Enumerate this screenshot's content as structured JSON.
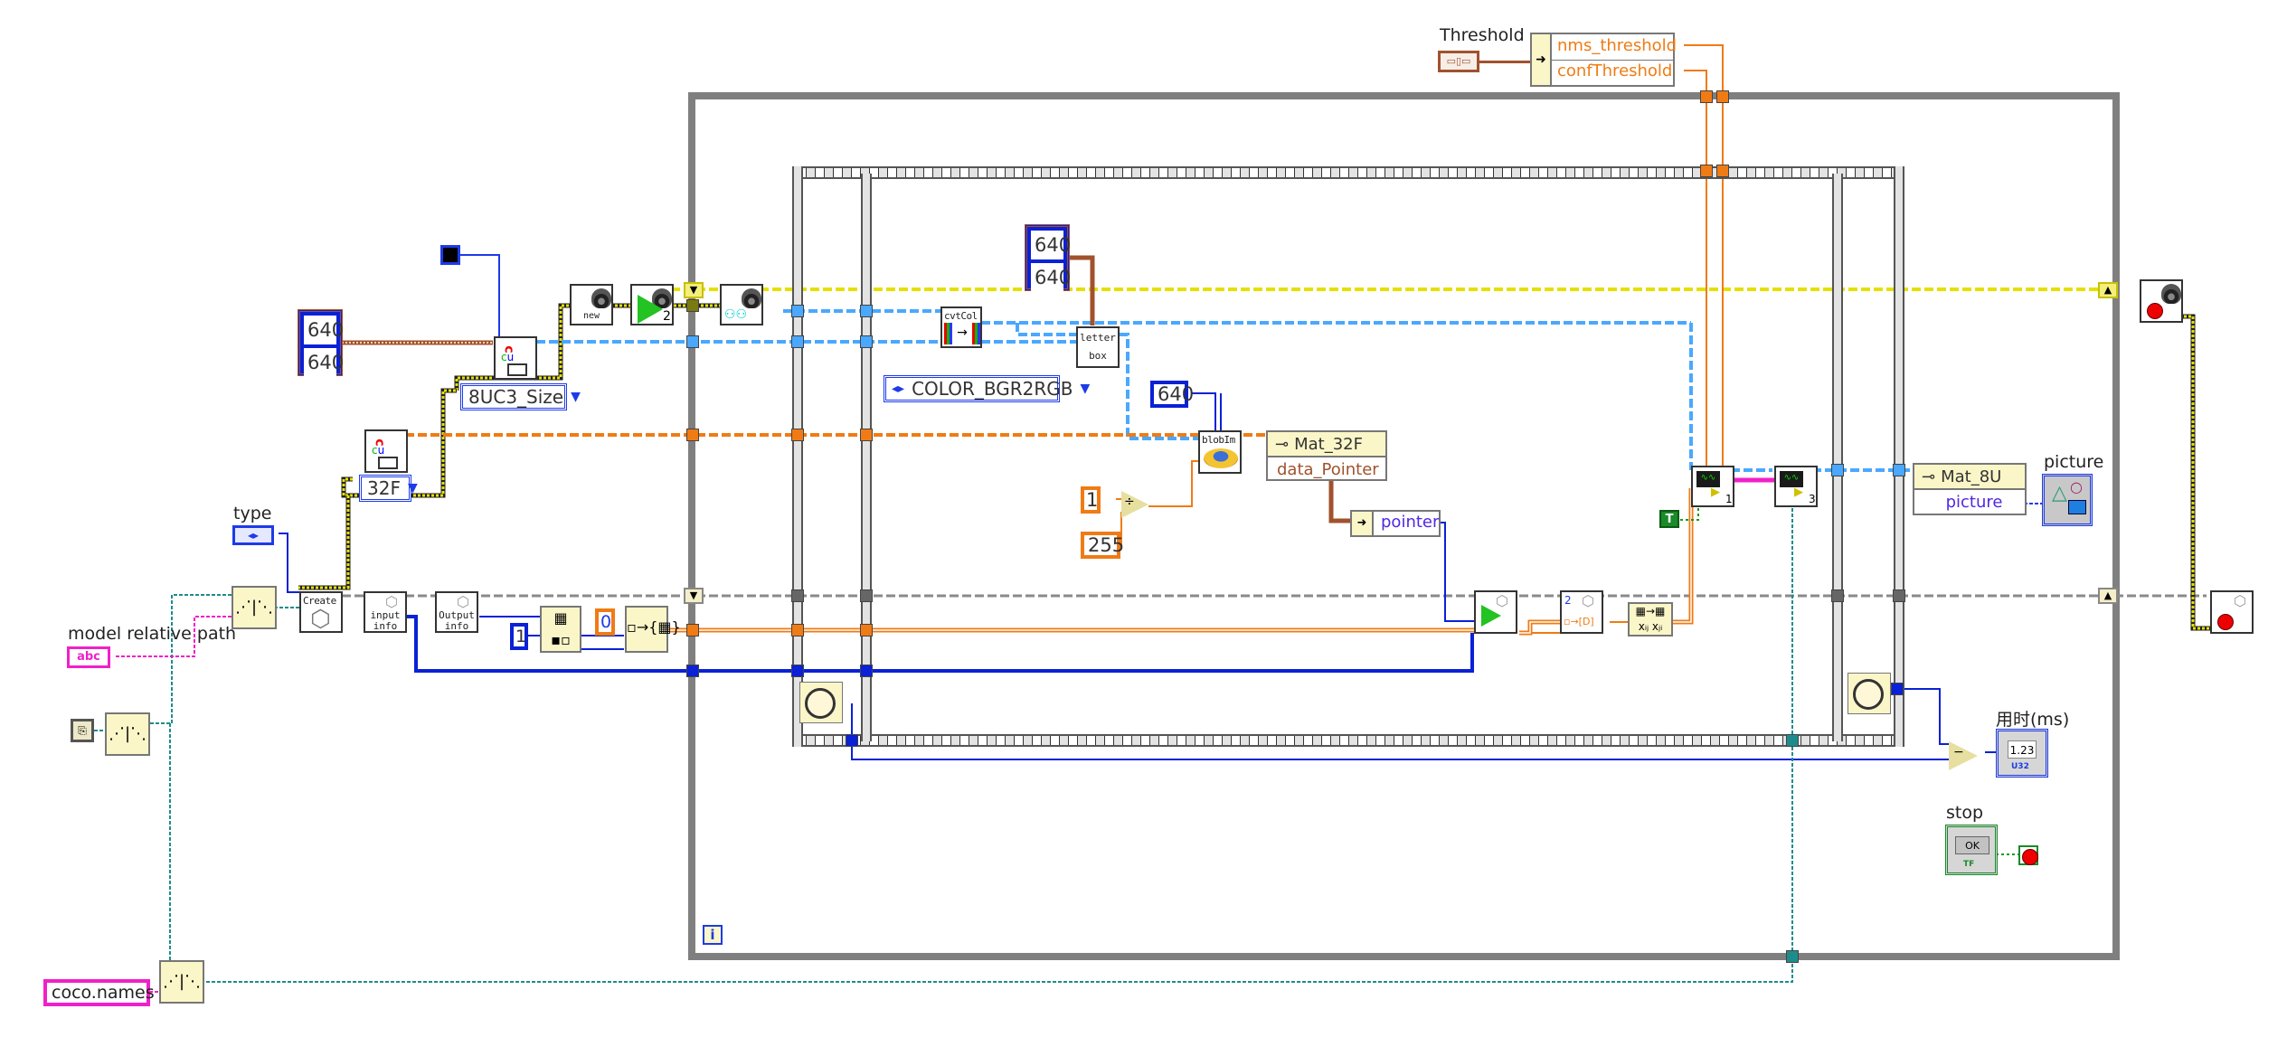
{
  "diagram": {
    "type": "LabVIEW block diagram",
    "controls": {
      "threshold": {
        "label": "Threshold",
        "bundle_fields": [
          "nms_threshold",
          "confThreshold"
        ]
      },
      "type": {
        "label": "type"
      },
      "model_path": {
        "label": "model relative path",
        "glyph": "abc"
      },
      "coco_names": {
        "value": "coco.names"
      },
      "stop": {
        "label": "stop",
        "button_text": "OK",
        "type_badge": "TF"
      }
    },
    "indicators": {
      "elapsed": {
        "label": "用时(ms)",
        "display": "1.23",
        "type_badge": "U32"
      },
      "picture": {
        "label": "picture"
      }
    },
    "constants": {
      "size_cluster_outer": [
        "640",
        "640"
      ],
      "size_cluster_inner": [
        "640",
        "640"
      ],
      "blob_size": "640",
      "div_numerator": "1",
      "div_denominator": "255",
      "index_zero": "0",
      "reshape_one": "1",
      "boolean_true": "T"
    },
    "rings": {
      "mat_type_8uc3": "8UC3_Size",
      "mat_type_32f": "32F",
      "color_conversion": "COLOR_BGR2RGB"
    },
    "subvis": {
      "camera_new": "new",
      "camera_start_index": "2",
      "dnn_create": "Create",
      "input_info": [
        "input",
        "info"
      ],
      "output_info": [
        "Output",
        "info"
      ],
      "cvtcolor": "cvtCol",
      "letterbox": [
        "letter",
        "box"
      ],
      "blob": "blobIm",
      "infer_output_index": "2",
      "draw_result_1": "1",
      "draw_result_3": "3"
    },
    "property_nodes": {
      "mat32f": {
        "class": "Mat_32F",
        "property": "data_Pointer"
      },
      "pointer_bundle": {
        "field": "pointer"
      },
      "mat8u": {
        "class": "Mat_8U",
        "property": "picture"
      }
    },
    "loop": {
      "iteration_terminal": "i"
    },
    "colors": {
      "wire_blue": "#0a21d6",
      "wire_orange": "#f07b14",
      "wire_teal": "#1f8c8c",
      "wire_pink": "#f020c8",
      "wire_yellow": "#e6e000",
      "wire_lightblue": "#4aa8ff",
      "wire_brown": "#a0522d",
      "wire_gray": "#8a8a8a",
      "loop_border": "#7f7f7f",
      "node_bg_yellow": "#fbf6c8"
    }
  }
}
